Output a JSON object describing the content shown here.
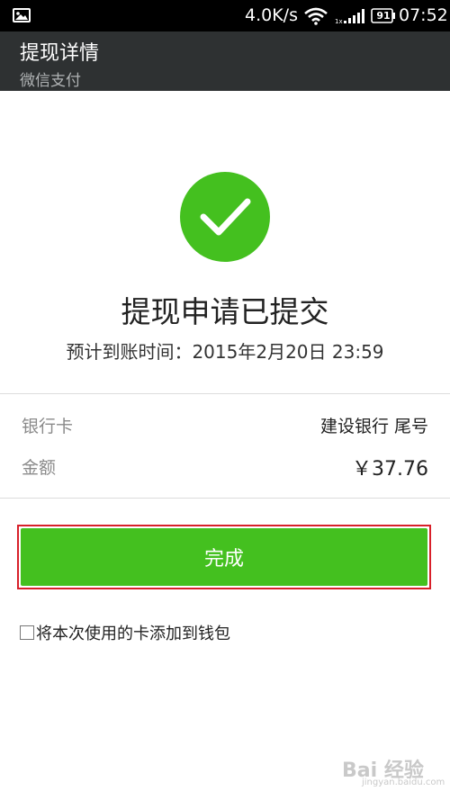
{
  "status_bar": {
    "network_speed": "4.0K/s",
    "battery_level": "91",
    "time": "07:52"
  },
  "header": {
    "title": "提现详情",
    "subtitle": "微信支付"
  },
  "result": {
    "title": "提现申请已提交",
    "arrival_time": "预计到账时间：2015年2月20日 23:59"
  },
  "details": {
    "bank_card_label": "银行卡",
    "bank_card_value": "建设银行 尾号",
    "amount_label": "金额",
    "amount_value": "￥37.76"
  },
  "actions": {
    "done_label": "完成"
  },
  "wallet_option": {
    "label": "将本次使用的卡添加到钱包",
    "checked": false
  },
  "watermark": {
    "text": "Bai 经验",
    "sub": "jingyan.baidu.com"
  },
  "colors": {
    "accent_green": "#44c01f",
    "header_bg": "#2e3132",
    "highlight_red": "#d8202a"
  }
}
